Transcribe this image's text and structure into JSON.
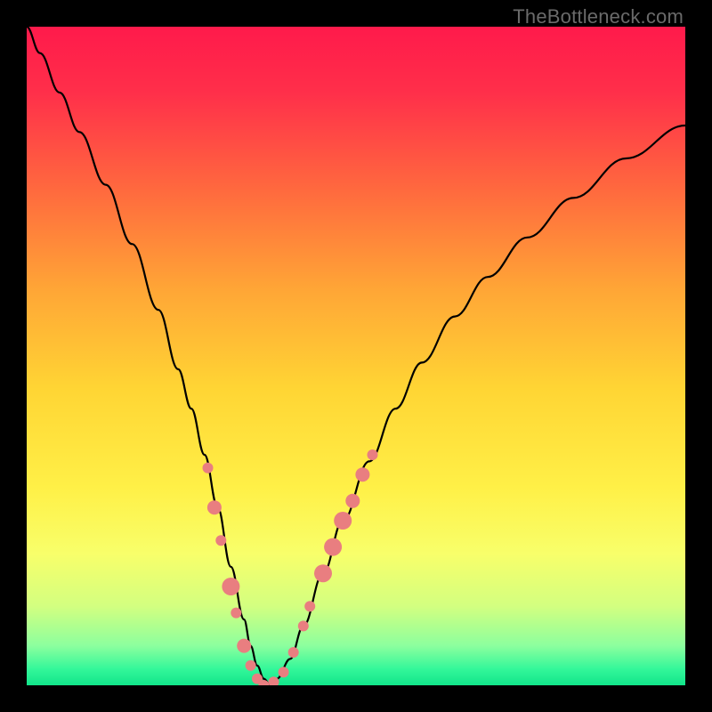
{
  "watermark": "TheBottleneck.com",
  "chart_data": {
    "type": "line",
    "title": "",
    "xlabel": "",
    "ylabel": "",
    "xlim": [
      0,
      100
    ],
    "ylim": [
      0,
      100
    ],
    "gradient_stops": [
      {
        "offset": 0.0,
        "color": "#ff1a4b"
      },
      {
        "offset": 0.1,
        "color": "#ff2f4a"
      },
      {
        "offset": 0.25,
        "color": "#ff6a3e"
      },
      {
        "offset": 0.4,
        "color": "#ffa636"
      },
      {
        "offset": 0.55,
        "color": "#ffd534"
      },
      {
        "offset": 0.7,
        "color": "#fff047"
      },
      {
        "offset": 0.8,
        "color": "#f8ff6a"
      },
      {
        "offset": 0.88,
        "color": "#d3ff80"
      },
      {
        "offset": 0.94,
        "color": "#8cff9e"
      },
      {
        "offset": 0.975,
        "color": "#34f79a"
      },
      {
        "offset": 1.0,
        "color": "#11e58a"
      }
    ],
    "series": [
      {
        "name": "bottleneck-curve",
        "x": [
          0,
          2,
          5,
          8,
          12,
          16,
          20,
          23,
          25,
          27,
          29,
          31,
          33,
          34,
          35,
          36,
          37,
          38,
          40,
          42,
          45,
          48,
          52,
          56,
          60,
          65,
          70,
          76,
          83,
          91,
          100
        ],
        "y": [
          100,
          96,
          90,
          84,
          76,
          67,
          57,
          48,
          42,
          35,
          27,
          18,
          10,
          6,
          3,
          1,
          0,
          1,
          4,
          9,
          17,
          25,
          34,
          42,
          49,
          56,
          62,
          68,
          74,
          80,
          85
        ]
      }
    ],
    "markers": {
      "name": "highlight-points",
      "color": "#e97e80",
      "points": [
        {
          "x": 27.5,
          "y": 33,
          "r": 6
        },
        {
          "x": 28.5,
          "y": 27,
          "r": 8
        },
        {
          "x": 29.5,
          "y": 22,
          "r": 6
        },
        {
          "x": 31.0,
          "y": 15,
          "r": 10
        },
        {
          "x": 31.8,
          "y": 11,
          "r": 6
        },
        {
          "x": 33.0,
          "y": 6,
          "r": 8
        },
        {
          "x": 34.0,
          "y": 3,
          "r": 6
        },
        {
          "x": 35.0,
          "y": 1,
          "r": 6
        },
        {
          "x": 36.0,
          "y": 0,
          "r": 6
        },
        {
          "x": 37.5,
          "y": 0.5,
          "r": 6
        },
        {
          "x": 39.0,
          "y": 2,
          "r": 6
        },
        {
          "x": 40.5,
          "y": 5,
          "r": 6
        },
        {
          "x": 42.0,
          "y": 9,
          "r": 6
        },
        {
          "x": 43.0,
          "y": 12,
          "r": 6
        },
        {
          "x": 45.0,
          "y": 17,
          "r": 10
        },
        {
          "x": 46.5,
          "y": 21,
          "r": 10
        },
        {
          "x": 48.0,
          "y": 25,
          "r": 10
        },
        {
          "x": 49.5,
          "y": 28,
          "r": 8
        },
        {
          "x": 51.0,
          "y": 32,
          "r": 8
        },
        {
          "x": 52.5,
          "y": 35,
          "r": 6
        }
      ]
    }
  }
}
